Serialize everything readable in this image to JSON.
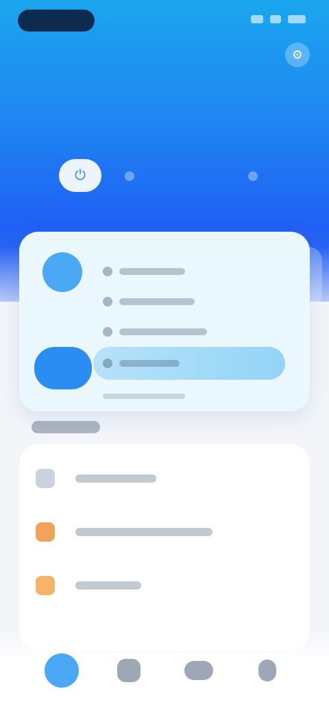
{
  "status_bar": {
    "icons": [
      "signal-icon",
      "wifi-icon",
      "battery-icon"
    ]
  },
  "header": {
    "title": "",
    "subtitle": "",
    "action_icon": "settings-icon"
  },
  "quick_toggles": {
    "icons": [
      "power-icon",
      "dot-icon",
      "dot-icon"
    ]
  },
  "panel": {
    "icons": [
      "shield-icon",
      "mode-icon"
    ],
    "rows": [
      "",
      "",
      "",
      ""
    ],
    "active_row": 3,
    "footer": ""
  },
  "section": {
    "label": ""
  },
  "list": {
    "items": [
      {
        "label": "",
        "icon": "key-icon",
        "color": "#c9d2de"
      },
      {
        "label": "",
        "icon": "warning-icon",
        "color": "#f2a35a"
      },
      {
        "label": "",
        "icon": "flag-icon",
        "color": "#f5b46c"
      }
    ]
  },
  "tabbar": {
    "tabs": [
      {
        "icon": "home-icon",
        "active": true
      },
      {
        "icon": "grid-icon",
        "active": false
      },
      {
        "icon": "chat-icon",
        "active": false
      },
      {
        "icon": "profile-icon",
        "active": false
      }
    ]
  },
  "colors": {
    "hero_top": "#1aa6ee",
    "hero_bottom": "#2060f4",
    "accent": "#4aa8f4",
    "panel_bg": "#eaf7fd",
    "page_bg": "#f3f5f9"
  }
}
